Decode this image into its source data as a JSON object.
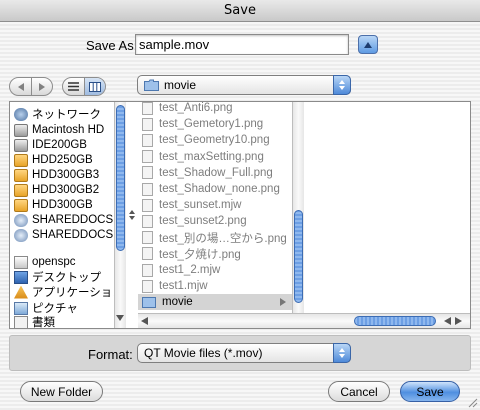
{
  "window": {
    "title": "Save"
  },
  "save_as": {
    "label": "Save As:",
    "value": "sample.mov"
  },
  "toolbar": {
    "location": "movie"
  },
  "sidebar": {
    "items": [
      {
        "label": "ネットワーク",
        "icon": "network-icon"
      },
      {
        "label": "Macintosh HD",
        "icon": "hard-disk-icon"
      },
      {
        "label": "IDE200GB",
        "icon": "hard-disk-icon"
      },
      {
        "label": "HDD250GB",
        "icon": "external-disk-icon"
      },
      {
        "label": "HDD300GB3",
        "icon": "external-disk-icon"
      },
      {
        "label": "HDD300GB2",
        "icon": "external-disk-icon"
      },
      {
        "label": "HDD300GB",
        "icon": "external-disk-icon"
      },
      {
        "label": "SHAREDDOCS",
        "icon": "network-volume-icon"
      },
      {
        "label": "SHAREDDOCS",
        "icon": "network-volume-icon"
      },
      {
        "label": "openspc",
        "icon": "home-icon"
      },
      {
        "label": "デスクトップ",
        "icon": "desktop-icon"
      },
      {
        "label": "アプリケーション",
        "icon": "applications-icon"
      },
      {
        "label": "ピクチャ",
        "icon": "pictures-icon"
      },
      {
        "label": "書類",
        "icon": "documents-icon"
      }
    ]
  },
  "files": [
    "test_Anti6.png",
    "test_Gemetory1.png",
    "test_Geometry10.png",
    "test_maxSetting.png",
    "test_Shadow_Full.png",
    "test_Shadow_none.png",
    "test_sunset.mjw",
    "test_sunset2.png",
    "test_別の場…空から.png",
    "test_夕焼け.png",
    "test1_2.mjw",
    "test1.mjw",
    "movie"
  ],
  "format": {
    "label": "Format:",
    "value": "QT Movie files (*.mov)"
  },
  "buttons": {
    "new_folder": "New Folder",
    "cancel": "Cancel",
    "save": "Save"
  },
  "colors": {
    "accent": "#4f8fe0",
    "selection": "#d4d4d4"
  }
}
